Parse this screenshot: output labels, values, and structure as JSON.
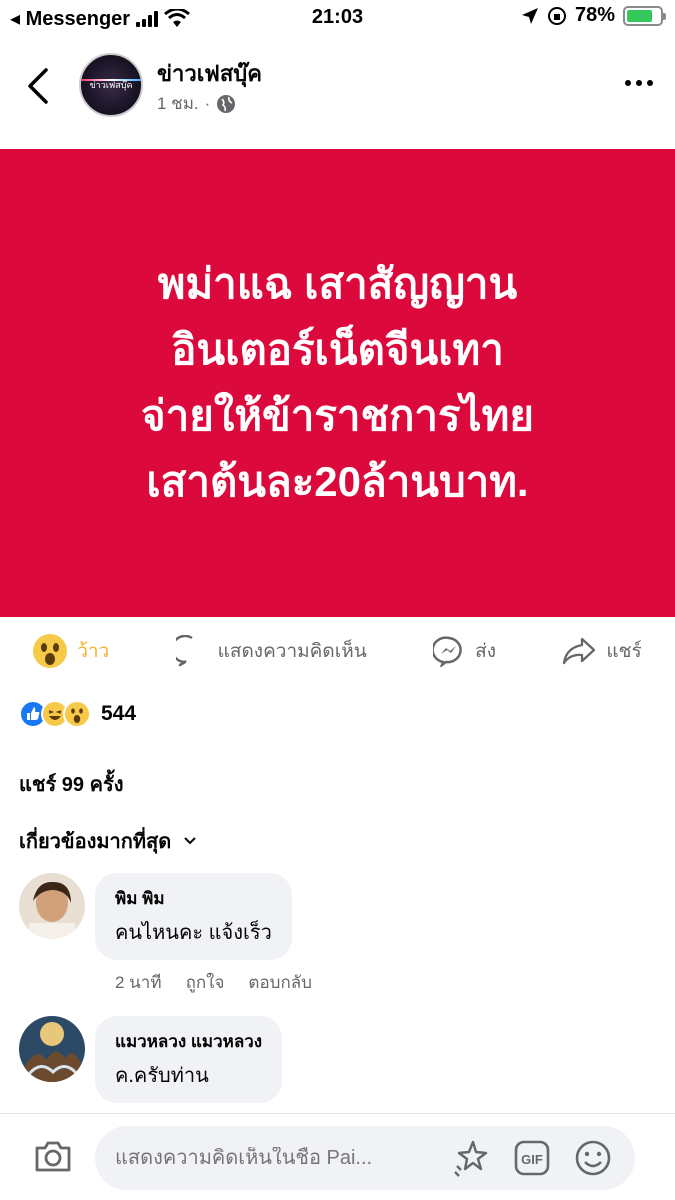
{
  "statusbar": {
    "back_app": "◂ Messenger",
    "time": "21:03",
    "battery": "78%",
    "battery_level": 0.78
  },
  "header": {
    "page_name": "ข่าวเฟสบุ๊ค",
    "avatar_text": "ข่าวเฟสบุ๊ค",
    "time_ago": "1 ชม.",
    "separator": "·"
  },
  "post": {
    "headline": "พม่าแฉ เสาสัญญาน\nอินเตอร์เน็ตจีนเทา\nจ่ายให้ข้าราชการไทย\nเสาต้นละ20ล้านบาท.",
    "background": "#dc0a3c"
  },
  "actions": {
    "react_label": "ว้าว",
    "comment_label": "แสดงความคิดเห็น",
    "send_label": "ส่ง",
    "share_label": "แชร์"
  },
  "reactions": {
    "count": "544"
  },
  "shares": {
    "text": "แชร์ 99 ครั้ง"
  },
  "sort": {
    "label": "เกี่ยวข้องมากที่สุด"
  },
  "comments": [
    {
      "name": "พิม พิม",
      "text": "คนไหนคะ  แจ้งเร็ว",
      "time": "2 นาที",
      "like": "ถูกใจ",
      "reply": "ตอบกลับ"
    },
    {
      "name": "แมวหลวง แมวหลวง",
      "text": "ค.ครับท่าน"
    }
  ],
  "composer": {
    "placeholder": "แสดงความคิดเห็นในชื่อ Pai..."
  }
}
